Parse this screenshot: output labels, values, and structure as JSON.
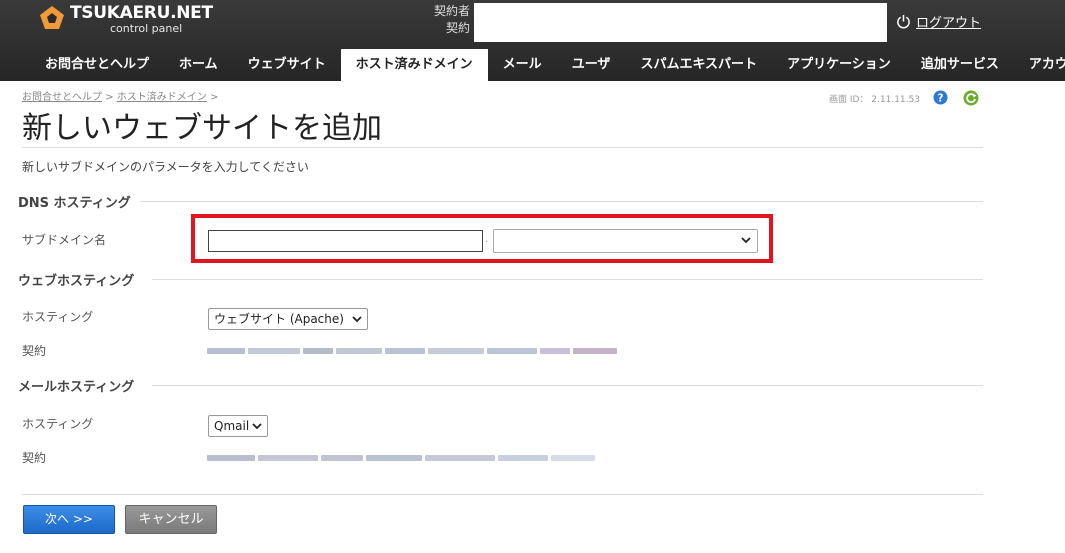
{
  "header": {
    "logo_title": "TSUKAERU.NET",
    "logo_sub": "control panel",
    "account_label_1": "契約者",
    "account_label_2": "契約",
    "logout_label": "ログアウト"
  },
  "nav": {
    "items": [
      {
        "label": "お問合せとヘルプ"
      },
      {
        "label": "ホーム"
      },
      {
        "label": "ウェブサイト"
      },
      {
        "label": "ホスト済みドメイン"
      },
      {
        "label": "メール"
      },
      {
        "label": "ユーザ"
      },
      {
        "label": "スパムエキスパート"
      },
      {
        "label": "アプリケーション"
      },
      {
        "label": "追加サービス"
      },
      {
        "label": "アカウント"
      }
    ],
    "active_index": 3
  },
  "breadcrumb": {
    "item1": "お問合せとヘルプ",
    "sep1": ">",
    "item2": "ホスト済みドメイン",
    "sep2": ">"
  },
  "screen_id": "画面 ID： 2.11.11.53",
  "page_title": "新しいウェブサイトを追加",
  "intro": "新しいサブドメインのパラメータを入力してください",
  "dns": {
    "section_title": "DNS ホスティング",
    "subdomain_label": "サブドメイン名",
    "subdomain_value": "",
    "separator": ".",
    "domain_selected": ""
  },
  "web": {
    "section_title": "ウェブホスティング",
    "hosting_label": "ホスティング",
    "hosting_value": "ウェブサイト (Apache)",
    "contract_label": "契約"
  },
  "mail": {
    "section_title": "メールホスティング",
    "hosting_label": "ホスティング",
    "hosting_value": "Qmail",
    "contract_label": "契約"
  },
  "buttons": {
    "next": "次へ >>",
    "cancel": "キャンセル"
  },
  "colors": {
    "highlight": "#e2141d",
    "primary_button": "#2a7bd8",
    "cancel_button": "#888888",
    "header_bg": "#2b2b2b"
  }
}
